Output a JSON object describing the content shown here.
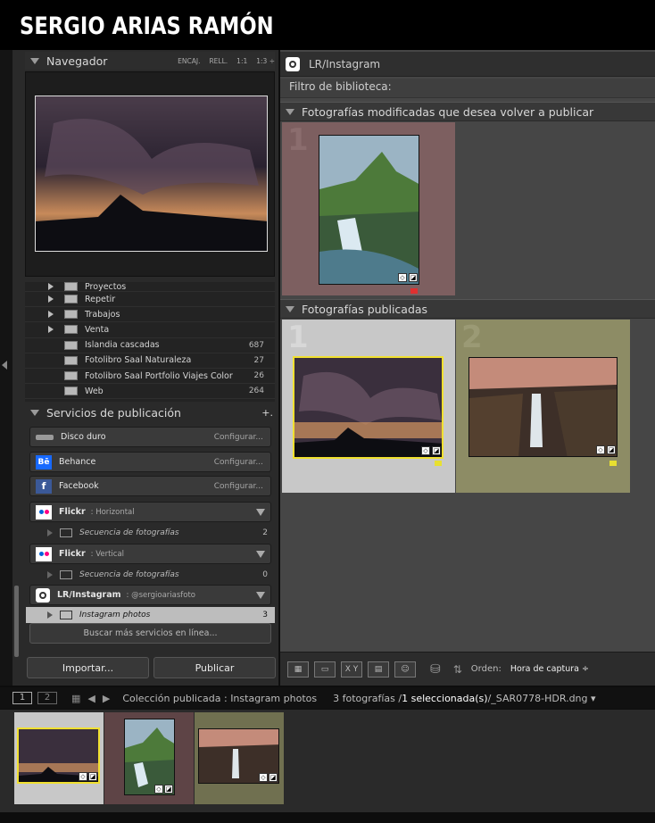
{
  "brand": {
    "name": "SERGIO ARIAS RAMÓN"
  },
  "navigator": {
    "title": "Navegador",
    "opts": [
      "ENCAJ.",
      "RELL.",
      "1:1",
      "1:3 ÷"
    ]
  },
  "collections": [
    {
      "label": "Proyectos",
      "count": ""
    },
    {
      "label": "Repetir",
      "count": ""
    },
    {
      "label": "Trabajos",
      "count": ""
    },
    {
      "label": "Venta",
      "count": ""
    },
    {
      "label": "Islandia cascadas",
      "count": "687"
    },
    {
      "label": "Fotolibro Saal Naturaleza",
      "count": "27"
    },
    {
      "label": "Fotolibro Saal Portfolio Viajes Color",
      "count": "26"
    },
    {
      "label": "Web",
      "count": "264"
    }
  ],
  "publish": {
    "title": "Servicios de publicación",
    "plus": "+.",
    "services": [
      {
        "name": "Disco duro",
        "extra": "",
        "cfg": "Configurar..."
      },
      {
        "name": "Behance",
        "extra": "",
        "cfg": "Configurar..."
      },
      {
        "name": "Facebook",
        "extra": "",
        "cfg": "Configurar..."
      }
    ],
    "flickr1": {
      "name": "Flickr",
      "extra": ": Horizontal",
      "sub": "Secuencia de fotografías",
      "count": "2"
    },
    "flickr2": {
      "name": "Flickr",
      "extra": ": Vertical",
      "sub": "Secuencia de fotografías",
      "count": "0"
    },
    "insta": {
      "name": "LR/Instagram",
      "extra": ": @sergioariasfoto",
      "sub": "Instagram photos",
      "count": "3"
    },
    "more": "Buscar más servicios en línea..."
  },
  "buttons": {
    "import": "Importar...",
    "publish": "Publicar"
  },
  "right": {
    "title": "LR/Instagram",
    "filter": "Filtro de biblioteca:",
    "modified": "Fotografías modificadas que desea volver a publicar",
    "published": "Fotografías publicadas",
    "nums": [
      "1",
      "1",
      "2"
    ]
  },
  "toolbar": {
    "xy": "X Y",
    "sortlabel": "Orden:",
    "sortvalue": "Hora de captura ÷"
  },
  "status": {
    "tab1": "1",
    "tab2": "2",
    "collection": "Colección publicada : Instagram photos",
    "count": "3 fotografías /",
    "selected": "1 seleccionada(s)",
    "file": " /_SAR0778-HDR.dng ▾"
  },
  "colors": {
    "accent": "#f0e030",
    "modified_bg": "#7d5f60",
    "selected_bg": "#c8c8c8",
    "olive_bg": "#8d8c65"
  }
}
